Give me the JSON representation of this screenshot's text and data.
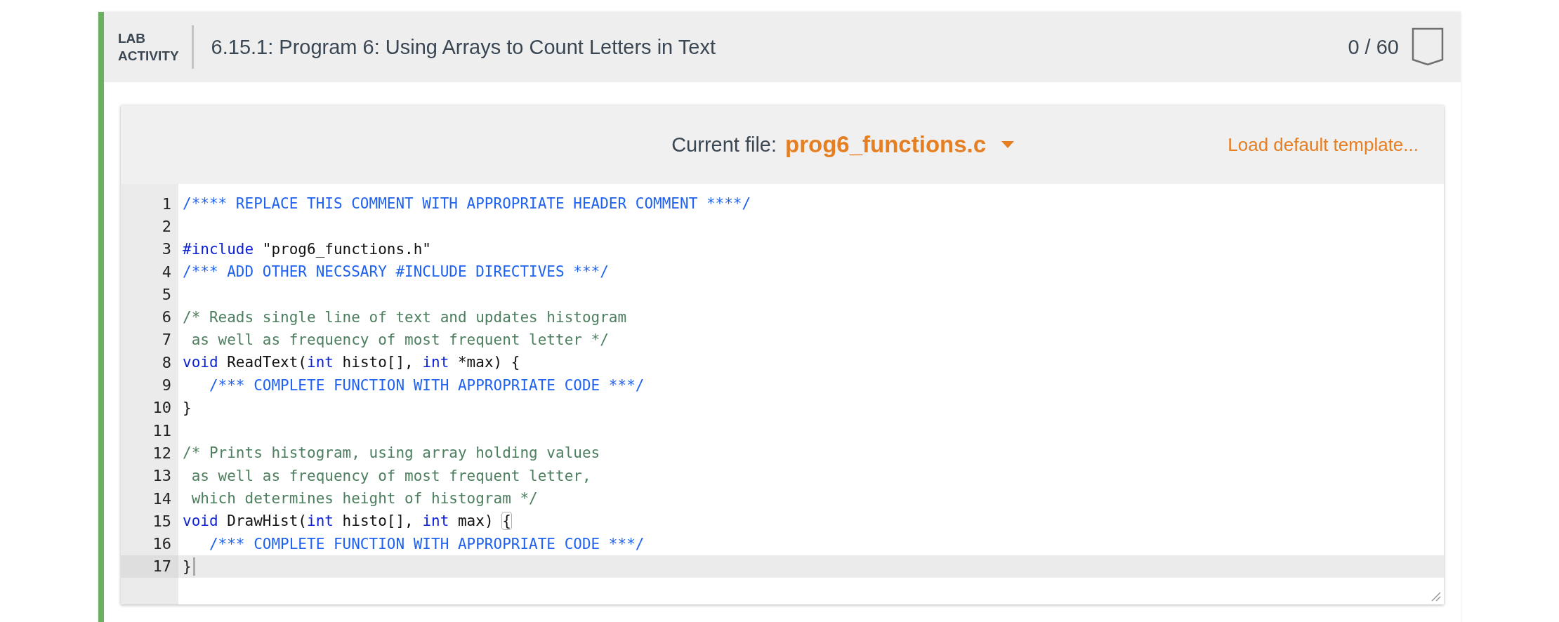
{
  "activity": {
    "label_lines": [
      "LAB",
      "ACTIVITY"
    ],
    "title": "6.15.1: Program 6: Using Arrays to Count Letters in Text",
    "score": "0 / 60"
  },
  "toolbar": {
    "file_label": "Current file:",
    "file_name": "prog6_functions.c",
    "load_link": "Load default template..."
  },
  "code_lines": [
    {
      "number": "1",
      "active": false,
      "tokens": [
        {
          "kind": "note",
          "text": "/**** REPLACE THIS COMMENT WITH APPROPRIATE HEADER COMMENT ****/"
        }
      ]
    },
    {
      "number": "2",
      "active": false
    },
    {
      "number": "3",
      "active": false,
      "tokens": [
        {
          "kind": "keyword",
          "text": "#include"
        },
        {
          "kind": "plain",
          "text": " \"prog6_functions.h\""
        }
      ]
    },
    {
      "number": "4",
      "active": false,
      "tokens": [
        {
          "kind": "note",
          "text": "/*** ADD OTHER NECSSARY #INCLUDE DIRECTIVES ***/"
        }
      ]
    },
    {
      "number": "5",
      "active": false
    },
    {
      "number": "6",
      "active": false,
      "tokens": [
        {
          "kind": "comment",
          "text": "/* Reads single line of text and updates histogram"
        }
      ]
    },
    {
      "number": "7",
      "active": false,
      "tokens": [
        {
          "kind": "comment",
          "text": " as well as frequency of most frequent letter */"
        }
      ]
    },
    {
      "number": "8",
      "active": false,
      "tokens": [
        {
          "kind": "keyword",
          "text": "void"
        },
        {
          "kind": "plain",
          "text": " ReadText("
        },
        {
          "kind": "keyword",
          "text": "int"
        },
        {
          "kind": "plain",
          "text": " histo[], "
        },
        {
          "kind": "keyword",
          "text": "int"
        },
        {
          "kind": "plain",
          "text": " *max) {"
        }
      ]
    },
    {
      "number": "9",
      "active": false,
      "tokens": [
        {
          "kind": "note",
          "text": "   /*** COMPLETE FUNCTION WITH APPROPRIATE CODE ***/"
        }
      ]
    },
    {
      "number": "10",
      "active": false,
      "tokens": [
        {
          "kind": "plain",
          "text": "}"
        }
      ]
    },
    {
      "number": "11",
      "active": false
    },
    {
      "number": "12",
      "active": false,
      "tokens": [
        {
          "kind": "comment",
          "text": "/* Prints histogram, using array holding values"
        }
      ]
    },
    {
      "number": "13",
      "active": false,
      "tokens": [
        {
          "kind": "comment",
          "text": " as well as frequency of most frequent letter,"
        }
      ]
    },
    {
      "number": "14",
      "active": false,
      "tokens": [
        {
          "kind": "comment",
          "text": " which determines height of histogram */"
        }
      ]
    },
    {
      "number": "15",
      "active": false,
      "tokens": [
        {
          "kind": "keyword",
          "text": "void"
        },
        {
          "kind": "plain",
          "text": " DrawHist("
        },
        {
          "kind": "keyword",
          "text": "int"
        },
        {
          "kind": "plain",
          "text": " histo[], "
        },
        {
          "kind": "keyword",
          "text": "int"
        },
        {
          "kind": "plain",
          "text": " max) "
        },
        {
          "kind": "matched",
          "text": "{"
        }
      ]
    },
    {
      "number": "16",
      "active": false,
      "tokens": [
        {
          "kind": "note",
          "text": "   /*** COMPLETE FUNCTION WITH APPROPRIATE CODE ***/"
        }
      ]
    },
    {
      "number": "17",
      "active": true,
      "tokens": [
        {
          "kind": "plain",
          "text": "}"
        }
      ]
    }
  ]
}
